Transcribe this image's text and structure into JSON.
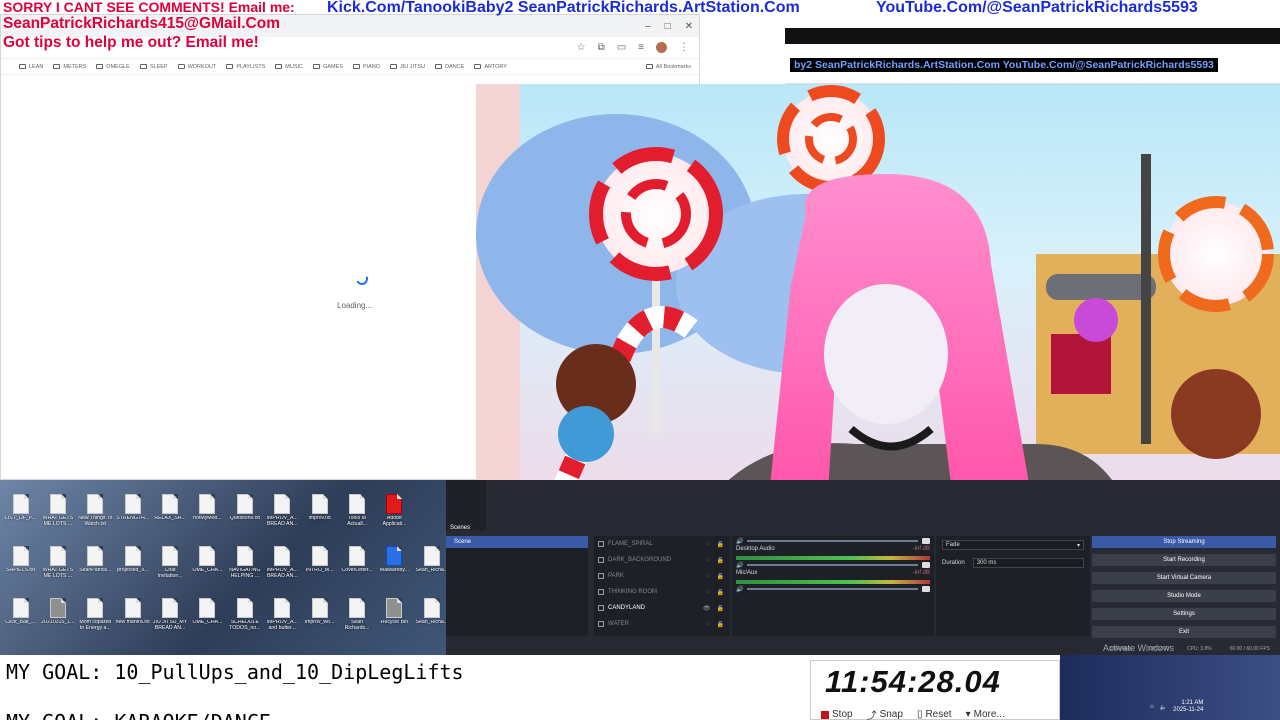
{
  "overlay": {
    "sorry_line": "SORRY I CANT SEE COMMENTS! Email me:",
    "kick_line": "Kick.Com/TanookiBaby2 SeanPatrickRichards.ArtStation.Com",
    "youtube_line": "YouTube.Com/@SeanPatrickRichards5593",
    "email_line": "SeanPatrickRichards415@GMail.Com",
    "tips_line": "Got tips to help me out? Email me!",
    "back_window_banner": "by2 SeanPatrickRichards.ArtStation.Com YouTube.Com/@SeanPatrickRichards5593"
  },
  "browser": {
    "window_controls": [
      "–",
      "□",
      "✕"
    ],
    "bookmarks": [
      {
        "label": "LEAN",
        "icon": "folder-icon"
      },
      {
        "label": "METERS",
        "icon": "folder-icon"
      },
      {
        "label": "OMEGLE",
        "icon": "omegle-icon"
      },
      {
        "label": "SLEEP",
        "icon": "folder-icon"
      },
      {
        "label": "WORKOUT",
        "icon": "folder-icon"
      },
      {
        "label": "PLAYLISTS",
        "icon": "folder-icon"
      },
      {
        "label": "MUSIC",
        "icon": "folder-icon"
      },
      {
        "label": "GAMES",
        "icon": "folder-icon"
      },
      {
        "label": "PIANO",
        "icon": "folder-icon"
      },
      {
        "label": "JIU JITSU",
        "icon": "folder-icon"
      },
      {
        "label": "DANCE",
        "icon": "folder-icon"
      },
      {
        "label": "ARTORY",
        "icon": "folder-icon"
      }
    ],
    "all_bookmarks": "All Bookmarks",
    "loading_text": "Loading..."
  },
  "desktop": {
    "icons": [
      {
        "label": "LIST_OF_P...",
        "kind": "file"
      },
      {
        "label": "WHAT GETS ME LOTS ...",
        "kind": "file"
      },
      {
        "label": "New Things To Watch.txt",
        "kind": "file"
      },
      {
        "label": "STRENGTH...",
        "kind": "file"
      },
      {
        "label": "RELAX_SH...",
        "kind": "file"
      },
      {
        "label": "notMyMod...",
        "kind": "file"
      },
      {
        "label": "Questions.txt",
        "kind": "file"
      },
      {
        "label": "IMPROV_A... BREAD AN...",
        "kind": "file"
      },
      {
        "label": "improv.txt",
        "kind": "file"
      },
      {
        "label": "Tools Id Actuall...",
        "kind": "file"
      },
      {
        "label": "Adobe Applicati...",
        "kind": "adobe"
      },
      {
        "label": "",
        "kind": "none"
      },
      {
        "label": "SHPIELS.txt",
        "kind": "file"
      },
      {
        "label": "WHAT GETS ME LOTS ...",
        "kind": "file"
      },
      {
        "label": "SeanPatrick...",
        "kind": "file"
      },
      {
        "label": "projected_Il...",
        "kind": "file"
      },
      {
        "label": "Chat Invitation...",
        "kind": "file"
      },
      {
        "label": "OME_CHA...",
        "kind": "file"
      },
      {
        "label": "NAVIGATING HELPING ...",
        "kind": "file"
      },
      {
        "label": "IMPROV_A... BREAD AN...",
        "kind": "file"
      },
      {
        "label": "INTRO_M...",
        "kind": "file"
      },
      {
        "label": "CoverLetter...",
        "kind": "file"
      },
      {
        "label": "Malwareby...",
        "kind": "malware"
      },
      {
        "label": "Sean_Richa...",
        "kind": "file"
      },
      {
        "label": "Click_Bait_...",
        "kind": "file"
      },
      {
        "label": "20210315_1...",
        "kind": "img"
      },
      {
        "label": "Mom copared to Energy a...",
        "kind": "file"
      },
      {
        "label": "new mantra.txt",
        "kind": "file"
      },
      {
        "label": "JIU JITSU_MY BREAD AN...",
        "kind": "file"
      },
      {
        "label": "OME_CHA...",
        "kind": "file"
      },
      {
        "label": "SCHEDULE TODOS_no...",
        "kind": "file"
      },
      {
        "label": "IMPROV_A... and butter...",
        "kind": "file"
      },
      {
        "label": "improv_wo...",
        "kind": "file"
      },
      {
        "label": "Sean Richards...",
        "kind": "file"
      },
      {
        "label": "Recycle Bin",
        "kind": "img"
      },
      {
        "label": "Sean_Richa...",
        "kind": "file"
      }
    ]
  },
  "obs": {
    "scenes_tab": "Scenes",
    "scene_selected": "Scene",
    "sources": [
      {
        "name": "FLAME_SPIRAL",
        "visible": false
      },
      {
        "name": "DARK_BACKGROUND",
        "visible": false
      },
      {
        "name": "PARK",
        "visible": false
      },
      {
        "name": "THINKING ROOM",
        "visible": false
      },
      {
        "name": "CANDYLAND",
        "visible": true
      },
      {
        "name": "WATER",
        "visible": false
      }
    ],
    "mixer": [
      {
        "name": "Desktop Audio",
        "db": "-inf dB"
      },
      {
        "name": "Mic/Aux",
        "db": "-inf dB"
      }
    ],
    "transition": {
      "type": "Fade",
      "duration_label": "Duration",
      "duration_value": "300 ms"
    },
    "controls": [
      "Stop Streaming",
      "Start Recording",
      "Start Virtual Camera",
      "Studio Mode",
      "Settings",
      "Exit"
    ],
    "status": {
      "kbps": "5660 kb/s",
      "time": "00:02:09",
      "cpu": "CPU: 3.8%",
      "fps": "60.00 / 60.00 FPS"
    }
  },
  "bottom": {
    "goal_line1": "MY GOAL: 10_PullUps_and_10_DipLegLifts",
    "goal_line2": "MY GOAL: KARAOKE/DANCE",
    "clock": "11:54:28.04",
    "clock_buttons": {
      "stop": "Stop",
      "snap": "Snap",
      "reset": "Reset",
      "more": "More..."
    },
    "activate_windows": "Activate Windows",
    "tray_time": "1:21 AM",
    "tray_date": "2025-11-24"
  },
  "colors": {
    "banner_red": "#e0003c",
    "banner_blue": "#1b2bd8",
    "obs_bg": "#272a33",
    "obs_accent": "#3a5aa8",
    "wig_pink": "#ff6fb8"
  }
}
